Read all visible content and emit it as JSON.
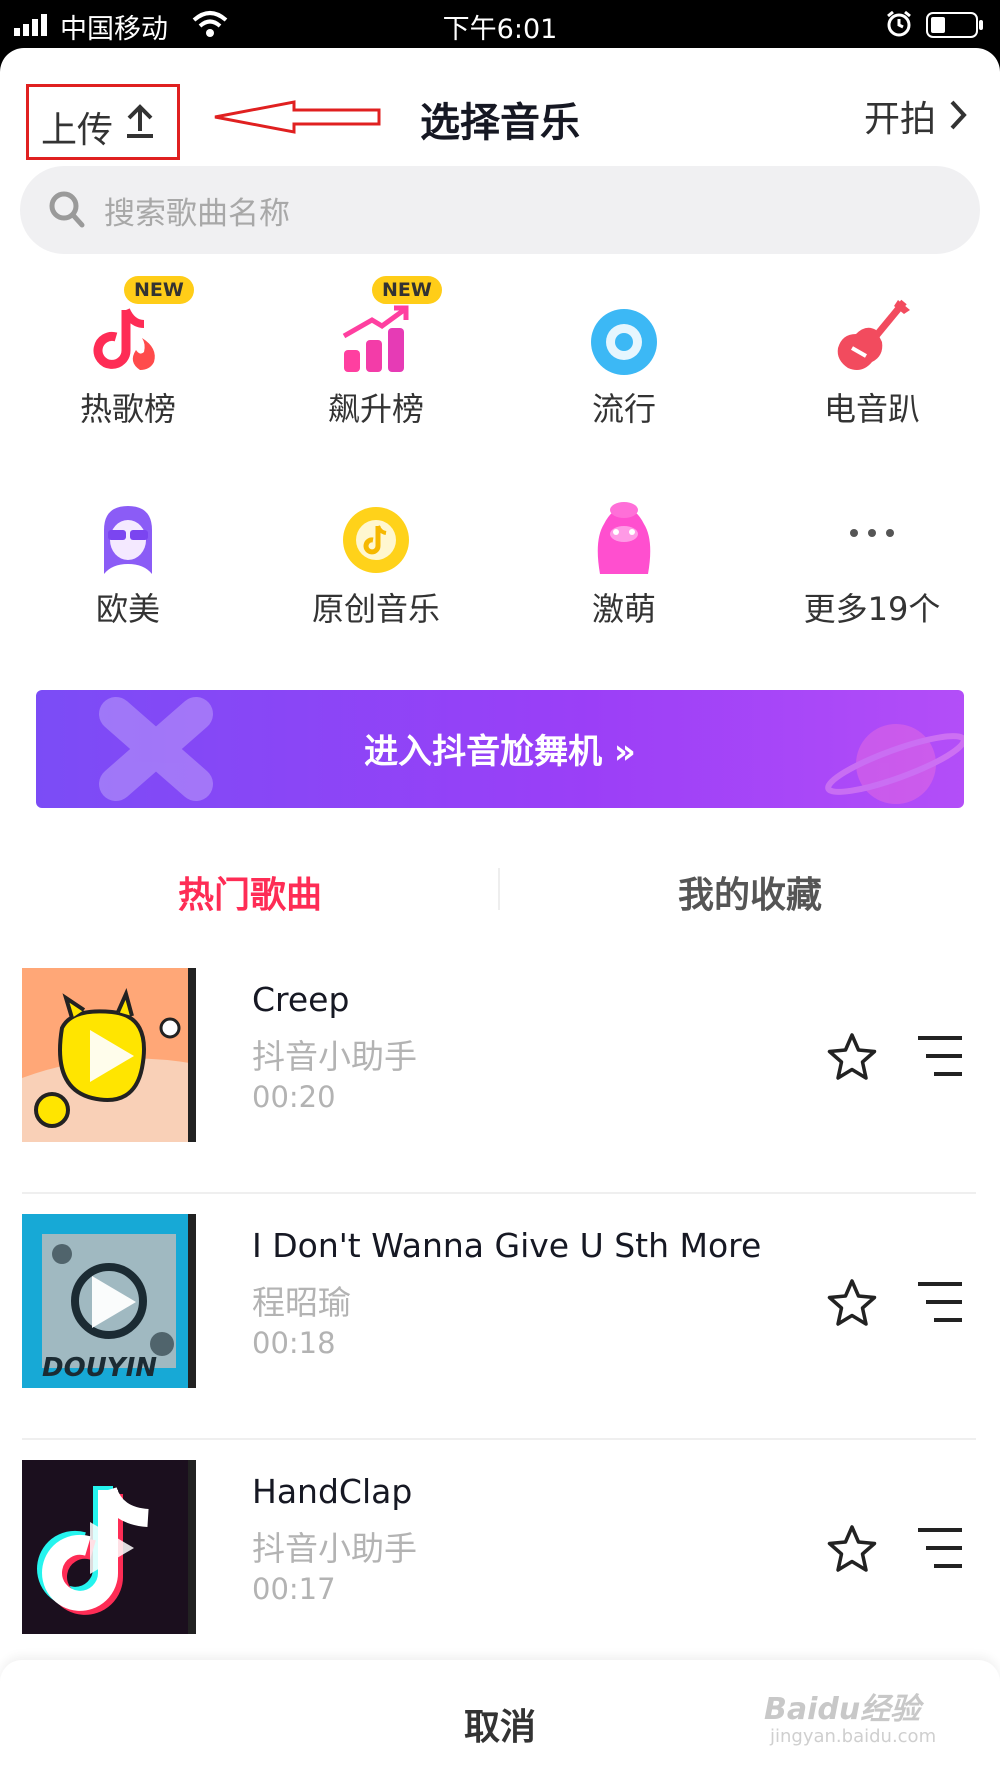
{
  "status_bar": {
    "carrier": "中国移动",
    "time": "下午6:01"
  },
  "header": {
    "upload_label": "上传",
    "title": "选择音乐",
    "shoot_label": "开拍"
  },
  "search": {
    "placeholder": "搜索歌曲名称"
  },
  "categories": [
    {
      "label": "热歌榜",
      "badge": "NEW"
    },
    {
      "label": "飙升榜",
      "badge": "NEW"
    },
    {
      "label": "流行"
    },
    {
      "label": "电音趴"
    },
    {
      "label": "欧美"
    },
    {
      "label": "原创音乐"
    },
    {
      "label": "激萌"
    },
    {
      "label": "更多19个"
    }
  ],
  "banner": {
    "label": "进入抖音尬舞机 »"
  },
  "tabs": [
    {
      "label": "热门歌曲",
      "active": true
    },
    {
      "label": "我的收藏",
      "active": false
    }
  ],
  "songs": [
    {
      "title": "Creep",
      "artist": "抖音小助手",
      "duration": "00:20"
    },
    {
      "title": "I Don't Wanna Give U Sth More",
      "artist": "程昭瑜",
      "duration": "00:18"
    },
    {
      "title": "HandClap",
      "artist": "抖音小助手",
      "duration": "00:17"
    }
  ],
  "footer": {
    "cancel_label": "取消"
  },
  "watermark": {
    "text": "Baidu经验",
    "url": "jingyan.baidu.com"
  },
  "colors": {
    "accent": "#fe2c55",
    "banner_start": "#7b4cf6",
    "banner_end": "#b34ef8",
    "annotation_red": "#e02020"
  }
}
